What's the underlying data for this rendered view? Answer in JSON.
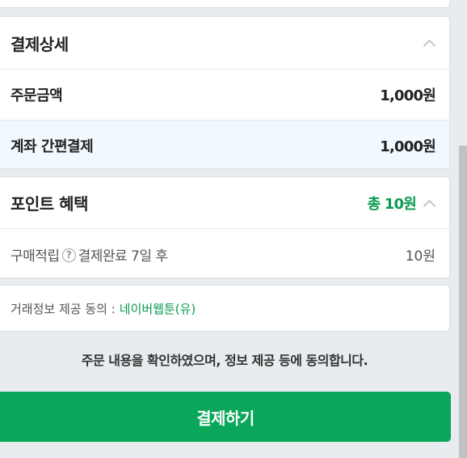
{
  "payment_detail": {
    "title": "결제상세",
    "rows": [
      {
        "label": "주문금액",
        "value": "1,000원"
      },
      {
        "label": "계좌 간편결제",
        "value": "1,000원"
      }
    ]
  },
  "point_benefit": {
    "title": "포인트 혜택",
    "total": "총 10원",
    "accent_color": "#0b9b4f",
    "item_label": "구매적립",
    "item_help": "?",
    "item_note": "결제완료 7일 후",
    "item_value": "10원"
  },
  "consent": {
    "label": "거래정보 제공 동의 :",
    "company": "네이버웹툰(유)"
  },
  "notice": "주문 내용을 확인하였으며, 정보 제공 등에 동의합니다.",
  "pay_button_label": "결제하기",
  "colors": {
    "button": "#0aa75b",
    "highlight_row": "#f1f8fe",
    "background": "#e9ecef"
  },
  "icons": [
    "chevron-up-icon",
    "help-circle-icon"
  ]
}
